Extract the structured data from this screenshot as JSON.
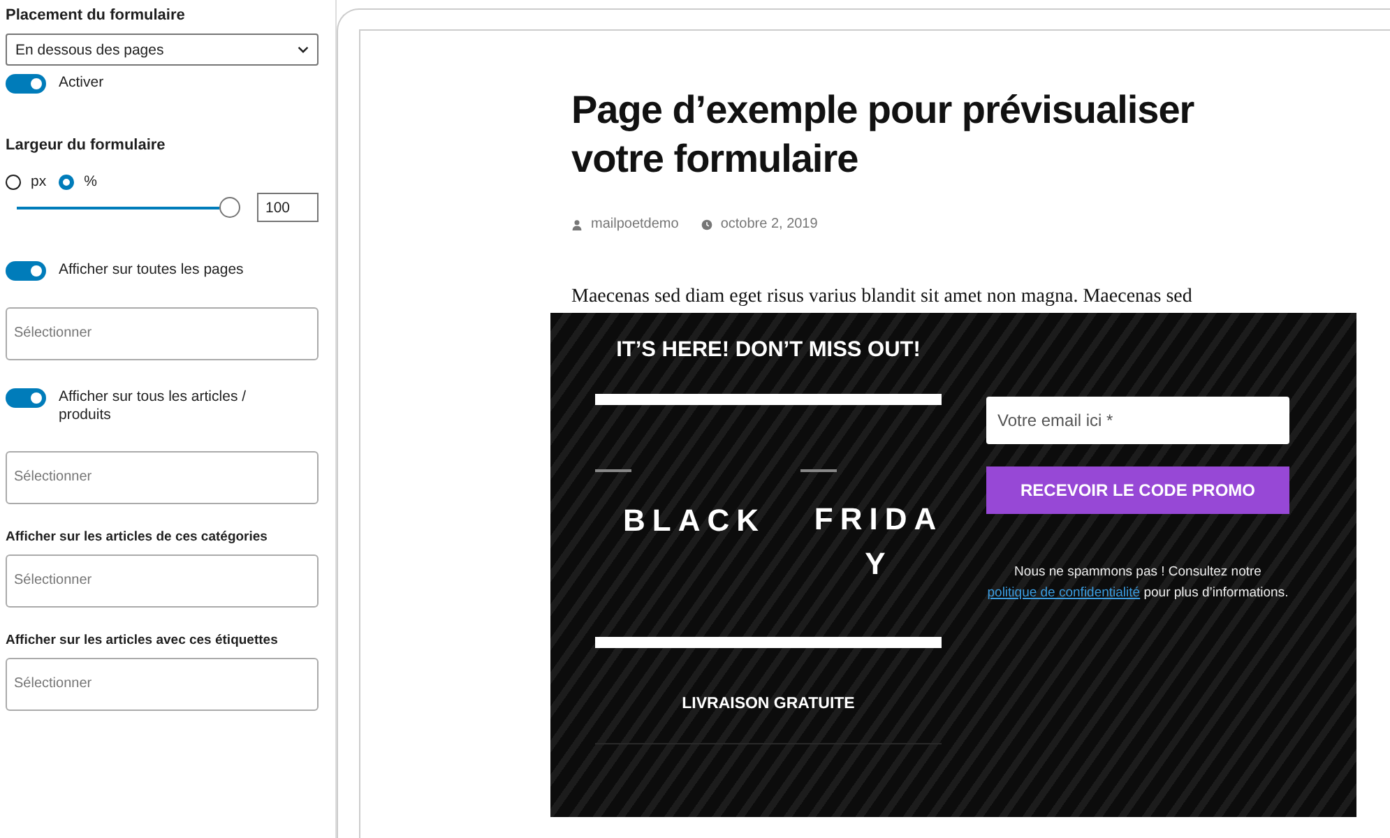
{
  "sidebar": {
    "fields": [
      {
        "kind": "heading",
        "label": "Placement du formulaire"
      },
      {
        "kind": "select",
        "value": "En dessous des pages"
      },
      {
        "kind": "toggle",
        "label": "Activer",
        "on": true
      },
      {
        "kind": "heading",
        "label": "Largeur du formulaire"
      },
      {
        "kind": "radios",
        "options": [
          {
            "label": "px",
            "selected": false
          },
          {
            "label": "%",
            "selected": true
          }
        ]
      },
      {
        "kind": "slider",
        "level": 1,
        "value": "100"
      },
      {
        "kind": "toggle",
        "label": "Afficher sur toutes les pages",
        "on": true
      },
      {
        "kind": "multiselect",
        "placeholder": "Sélectionner"
      },
      {
        "kind": "toggle",
        "label": "Afficher sur tous les articles / produits",
        "on": true
      },
      {
        "kind": "multiselect",
        "placeholder": "Sélectionner"
      },
      {
        "kind": "label",
        "label": "Afficher sur les articles de ces catégories"
      },
      {
        "kind": "multiselect",
        "placeholder": "Sélectionner"
      },
      {
        "kind": "label",
        "label": "Afficher sur les articles avec ces étiquettes"
      },
      {
        "kind": "multiselect",
        "placeholder": "Sélectionner"
      }
    ]
  },
  "preview": {
    "title": "Page d’exemple pour prévisualiser votre formulaire",
    "author": "mailpoetdemo",
    "date": "octobre 2, 2019",
    "paragraph": "Maecenas sed diam eget risus varius blandit sit amet non magna. Maecenas sed",
    "popup": {
      "heading": "IT’S HERE! DON’T MISS OUT!",
      "word_1": "BLACK",
      "word_2": "FRIDAY",
      "footer": "LIVRAISON GRATUITE",
      "email_placeholder": "Votre email ici *",
      "button": "RECEVOIR LE CODE PROMO",
      "note_before": "Nous ne spammons pas ! Consultez notre ",
      "note_link": "politique de confidentialité",
      "note_after": " pour plus d’informations."
    }
  }
}
